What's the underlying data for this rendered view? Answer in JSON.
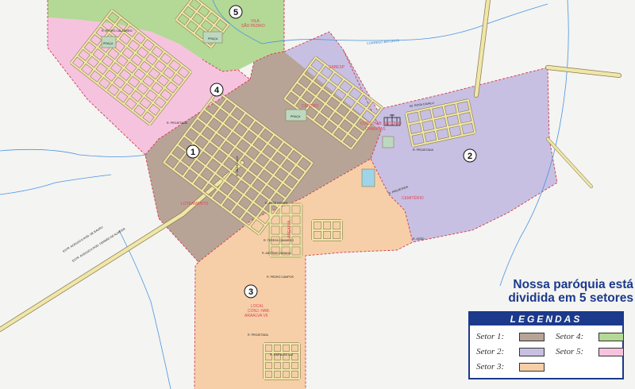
{
  "map": {
    "sectors": [
      {
        "number": "1",
        "color": "#b7a496",
        "labels": [
          "LOTEAMENTO"
        ]
      },
      {
        "number": "2",
        "color": "#c7c0e2",
        "labels": [
          "CEMITÉRIO",
          "CONJ. HAB. ANTÔNIO",
          "OVARINAS"
        ]
      },
      {
        "number": "3",
        "color": "#f6cfa8",
        "labels": [
          "LOCAL",
          "CONJ. HAB.",
          "ARAALVA VII"
        ]
      },
      {
        "number": "4",
        "color": "#f6c3df",
        "labels": []
      },
      {
        "number": "5",
        "color": "#b4d896",
        "labels": [
          "VILA",
          "SÃO PEDRO"
        ]
      }
    ],
    "places": [
      "PRAÇA",
      "PRAÇA",
      "PRAÇA",
      "CENTRO",
      "SABESP",
      "AREALVA"
    ],
    "creek": "CORREGO BATURITÁ",
    "highways": [
      "ESTR. ACESSO A ROD. FERNÃO DE ALMEIDA",
      "ESTR. ACESSO A ROD. DE BAURU"
    ],
    "streets": [
      "R. PROJETADA",
      "R. PROJETADA",
      "R. PROJETADA",
      "R. PROJETADA",
      "R. PEDRO CALABRESI",
      "R. JOSÉ GOMES",
      "R. TEREZA CAMARGO",
      "R. ANTÔNIO ZANAGA",
      "R. PEDRO CAMPOS",
      "R. SÃO PAULO",
      "AV. ROSA CAVALLI",
      "R. ADÃO",
      "R. MARIA DA LUZ"
    ]
  },
  "title": {
    "line1": "Nossa paróquia está",
    "line2": "dividida em 5 setores"
  },
  "legend": {
    "heading": "LEGENDAS",
    "items": [
      {
        "label": "Setor 1:",
        "color": "#b7a496"
      },
      {
        "label": "Setor 2:",
        "color": "#c7c0e2"
      },
      {
        "label": "Setor 3:",
        "color": "#f6cfa8"
      },
      {
        "label": "Setor 4:",
        "color": "#b4d896"
      },
      {
        "label": "Setor 5:",
        "color": "#f6c3df"
      }
    ]
  }
}
